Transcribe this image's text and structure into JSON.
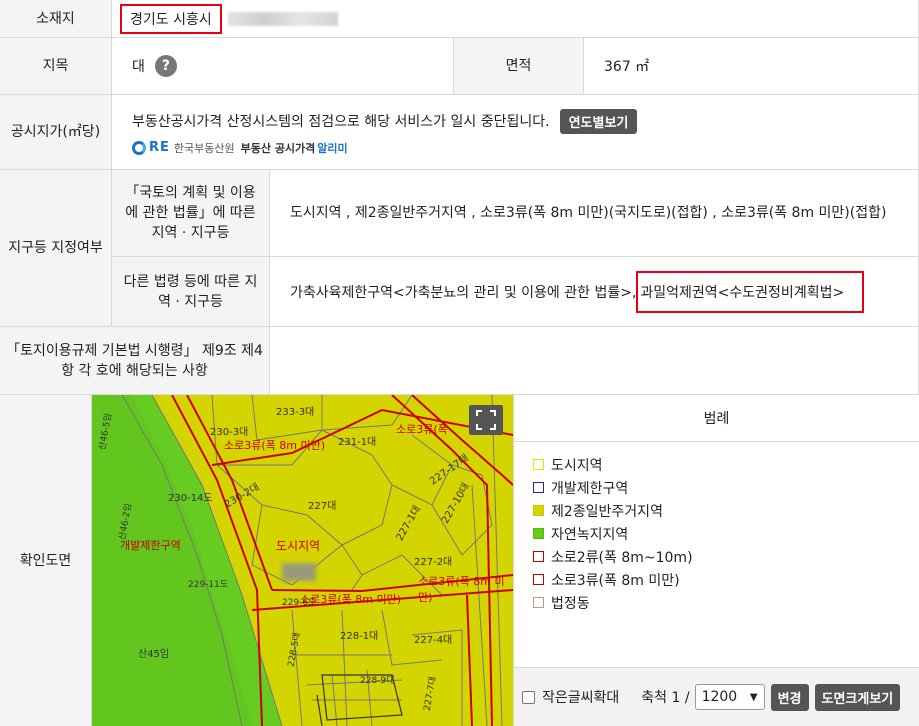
{
  "rows": {
    "location": {
      "label": "소재지",
      "value": "경기도 시흥시"
    },
    "land_category": {
      "label": "지목",
      "value": "대",
      "help_icon": "?"
    },
    "area": {
      "label": "면적",
      "value": "367 ㎡"
    },
    "price": {
      "label": "공시지가(㎡당)",
      "notice": "부동산공시가격 산정시스템의 점검으로 해당 서비스가 일시 중단됩니다.",
      "button": "연도별보기",
      "logo_mark": "RE",
      "logo_org": "한국부동산원",
      "logo_service": "부동산 공시가격",
      "logo_service_accent": "알리미"
    },
    "zoning": {
      "label": "지구등 지정여부",
      "sub1_label": "「국토의 계획 및 이용에 관한 법률」에 따른 지역 · 지구등",
      "sub1_value": "도시지역 , 제2종일반주거지역 , 소로3류(폭 8m 미만)(국지도로)(접합) , 소로3류(폭 8m 미만)(접합)",
      "sub2_label": "다른 법령 등에 따른 지역 · 지구등",
      "sub2_value_a": "가축사육제한구역<가축분뇨의 관리 및 이용에 관한 법률>, ",
      "sub2_value_b": "과밀억제권역<수도권정비계획법>"
    },
    "regulation": {
      "label": "「토지이용규제 기본법 시행령」 제9조 제4항 각 호에 해당되는 사항",
      "value": ""
    },
    "map": {
      "label": "확인도면"
    }
  },
  "map_labels": {
    "p1": "233-3대",
    "p2": "230-3대",
    "p3": "231-1대",
    "p4": "230-14도",
    "p5": "230-2대",
    "p6": "227대",
    "p7": "227-17대",
    "p8": "227-10대",
    "p9": "227-1대",
    "p10": "227-2대",
    "p11": "229-11도",
    "p12": "229-6도",
    "p13": "228-1대",
    "p14": "227-4대",
    "p15": "228-5대",
    "p16": "228-9대",
    "p17": "227-7대",
    "p18": "산45임",
    "p19": "산46-5임",
    "p20": "산46-2임",
    "z1": "소로3류(폭 8m 미만)",
    "z2": "소로3류(폭",
    "z3": "개발제한구역",
    "z4": "도시지역",
    "z5": "소로3류(폭 8m 미만)",
    "z6": "소로3류(폭 8m 미만)"
  },
  "legend": {
    "title": "범례",
    "items": [
      {
        "label": "도시지역",
        "color": "#e6e600",
        "fill": "#ffffff"
      },
      {
        "label": "개발제한구역",
        "color": "#2222aa",
        "fill": "#ffffff"
      },
      {
        "label": "제2종일반주거지역",
        "color": "#c8c800",
        "fill": "#d4d400"
      },
      {
        "label": "자연녹지지역",
        "color": "#55bb00",
        "fill": "#66cc22"
      },
      {
        "label": "소로2류(폭 8m~10m)",
        "color": "#cc0000",
        "fill": "#ffffff"
      },
      {
        "label": "소로3류(폭 8m 미만)",
        "color": "#cc0000",
        "fill": "#ffffff"
      },
      {
        "label": "법정동",
        "color": "#b0a080",
        "fill": "#ffffff"
      }
    ]
  },
  "controls": {
    "checkbox_label": "작은글씨확대",
    "scale_label": "축척 1 /",
    "scale_value": "1200",
    "change_button": "변경",
    "enlarge_button": "도면크게보기"
  },
  "colors": {
    "highlight": "#e60012",
    "zone_yellow": "#d4d400",
    "zone_green": "#66cc22",
    "road_red": "#cc0000"
  }
}
